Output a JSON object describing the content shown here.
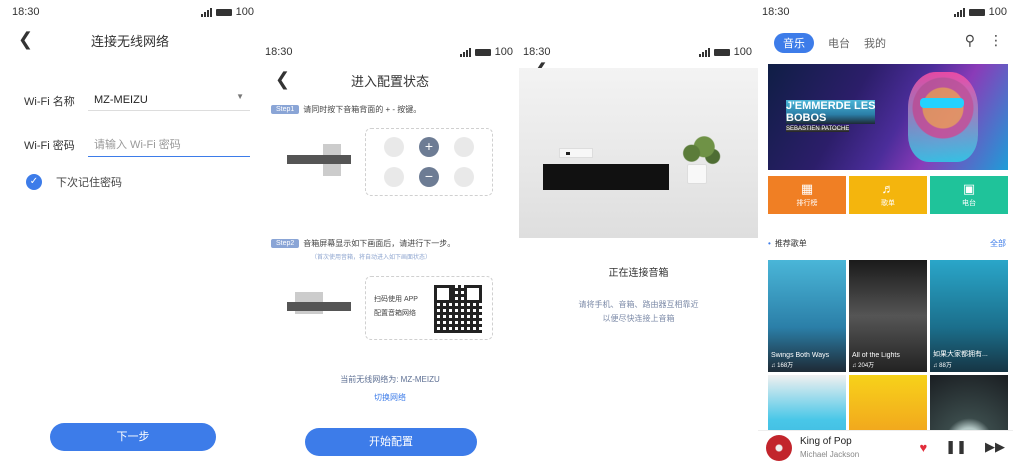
{
  "status": {
    "time": "18:30",
    "battery": "100"
  },
  "screen1": {
    "title": "连接无线网络",
    "wifi_name_label": "Wi-Fi 名称",
    "wifi_name_value": "MZ-MEIZU",
    "wifi_pwd_label": "Wi-Fi 密码",
    "wifi_pwd_placeholder": "请输入 Wi-Fi 密码",
    "remember_label": "下次记住密码",
    "next_button": "下一步"
  },
  "screen2": {
    "title": "进入配置状态",
    "step1_tag": "Step1",
    "step1_text": "请同时按下音箱背面的 + - 按键。",
    "step2_tag": "Step2",
    "step2_text": "音箱屏幕显示如下画面后，请进行下一步。",
    "step2_note": "（首次使用音箱，将自动进入如下画面状态）",
    "qr_text_1": "扫码使用 APP",
    "qr_text_2": "配置音箱网络",
    "current_network": "当前无线网络为: MZ-MEIZU",
    "switch_network": "切换网络",
    "start_button": "开始配置"
  },
  "screen3": {
    "status_title": "正在连接音箱",
    "status_desc_1": "请将手机、音箱、路由器互相靠近",
    "status_desc_2": "以便尽快连接上音箱"
  },
  "screen4": {
    "tabs": [
      "音乐",
      "电台",
      "我的"
    ],
    "banner_title_1": "J'EMMERDE LES",
    "banner_title_2": "BOBOS",
    "banner_artist": "SEBASTIEN PATOCHE",
    "categories": [
      {
        "label": "排行榜",
        "color": "#f07f24"
      },
      {
        "label": "歌单",
        "color": "#f4b50d"
      },
      {
        "label": "电台",
        "color": "#1fc39a"
      }
    ],
    "section_title": "推荐歌单",
    "section_all": "全部",
    "playlists": [
      {
        "title": "Swings Both Ways",
        "plays": "168万"
      },
      {
        "title": "All of the Lights",
        "plays": "204万"
      },
      {
        "title": "如果大家都拥有...",
        "plays": "88万"
      }
    ],
    "now_playing": {
      "song": "King of Pop",
      "artist": "Michael Jackson"
    }
  }
}
